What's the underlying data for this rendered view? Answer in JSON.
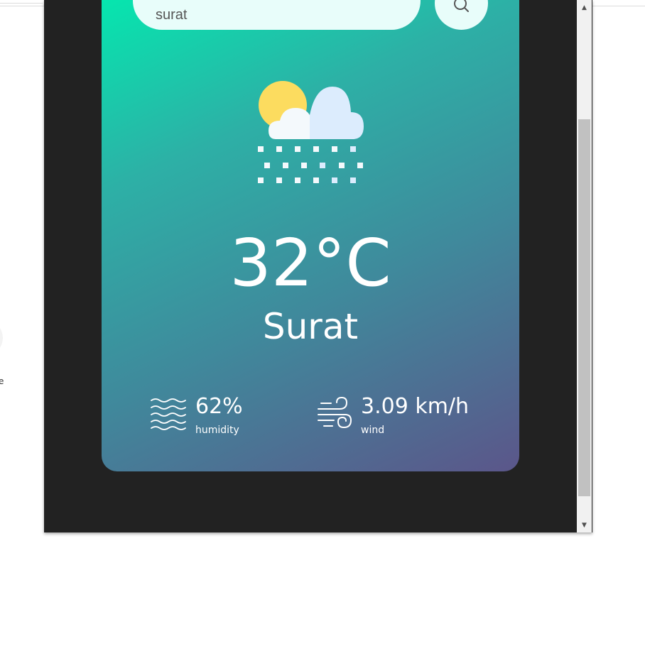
{
  "search": {
    "value": "surat",
    "icon": "search-icon"
  },
  "weather": {
    "condition_icon": "cloud-sun-rain-icon",
    "temperature": "32°C",
    "city": "Surat"
  },
  "details": {
    "humidity_value": "62%",
    "humidity_label": "humidity",
    "humidity_icon": "humidity-waves-icon",
    "wind_value": "3.09 km/h",
    "wind_label": "wind",
    "wind_icon": "wind-icon"
  },
  "background_fragment": {
    "letter": "e"
  },
  "colors": {
    "gradient_start": "#00eeb0",
    "gradient_end": "#5b568a",
    "window_bg": "#222222",
    "search_bg": "#e8fdfa"
  }
}
